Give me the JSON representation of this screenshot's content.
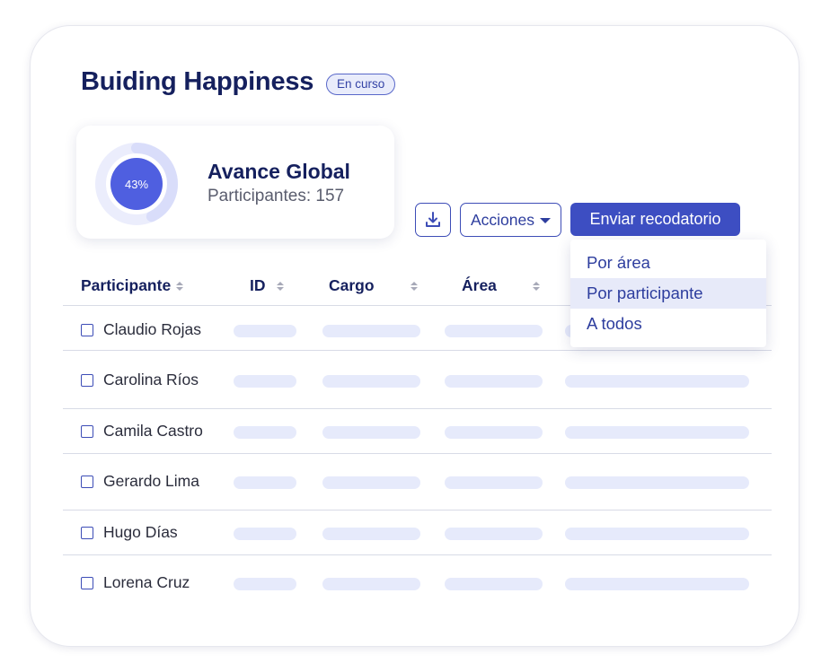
{
  "header": {
    "title": "Buiding Happiness",
    "status_badge": "En curso"
  },
  "progress": {
    "percent_label": "43%",
    "percent_value": 0.43,
    "title": "Avance Global",
    "participants_label": "Participantes: 157"
  },
  "toolbar": {
    "download_icon": "download-icon",
    "actions_label": "Acciones",
    "send_reminder_label": "Enviar recodatorio"
  },
  "reminder_menu": {
    "items": [
      {
        "label": "Por área",
        "active": false
      },
      {
        "label": "Por participante",
        "active": true
      },
      {
        "label": "A todos",
        "active": false
      }
    ]
  },
  "table": {
    "columns": [
      "Participante",
      "ID",
      "Cargo",
      "Área"
    ],
    "rows": [
      {
        "name": "Claudio Rojas"
      },
      {
        "name": "Carolina Ríos"
      },
      {
        "name": "Camila Castro"
      },
      {
        "name": "Gerardo Lima"
      },
      {
        "name": "Hugo Días"
      },
      {
        "name": "Lorena Cruz"
      }
    ]
  },
  "colors": {
    "primary": "#3d4ec2",
    "title": "#15205e",
    "donut_outer": "#dde1fb",
    "donut_inner": "#4f5fe0",
    "skeleton": "#e6eafb"
  }
}
